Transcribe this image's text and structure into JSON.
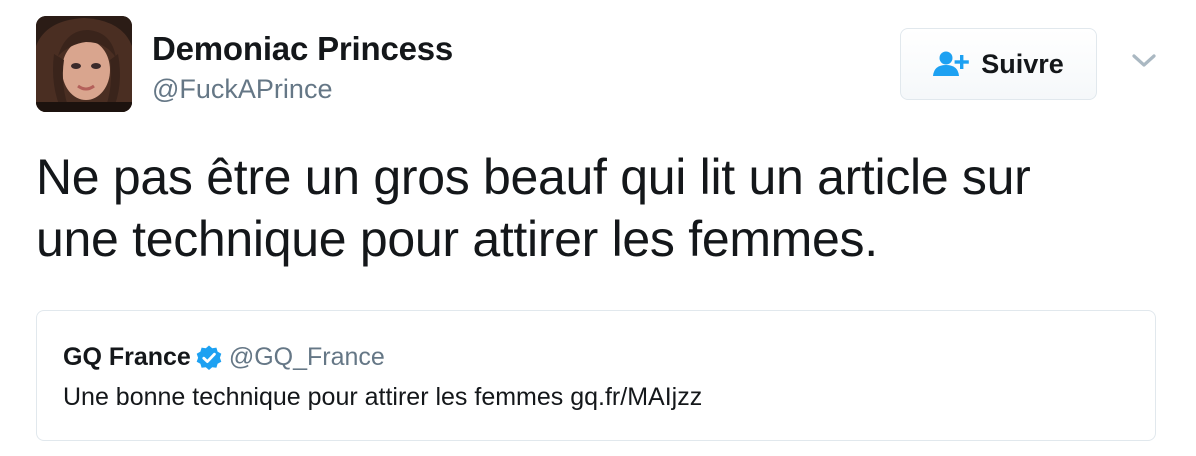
{
  "author": {
    "name": "Demoniac Princess",
    "handle": "@FuckAPrince",
    "avatar_icon": "profile-photo"
  },
  "follow_button": {
    "label": "Suivre",
    "icon": "add-user-icon",
    "icon_color": "#1da1f2"
  },
  "menu_caret": {
    "icon": "chevron-down-icon"
  },
  "tweet": {
    "line1": "Ne pas être un gros beauf qui lit un article sur",
    "line2": "une technique pour attirer les femmes."
  },
  "quoted_tweet": {
    "name": "GQ France",
    "verified": true,
    "verified_color": "#1da1f2",
    "handle": "@GQ_France",
    "text": "Une bonne technique pour attirer les femmes gq.fr/MAIjzz"
  },
  "colors": {
    "text_primary": "#14171a",
    "text_secondary": "#657786",
    "border": "#e1e8ed",
    "accent": "#1da1f2"
  }
}
